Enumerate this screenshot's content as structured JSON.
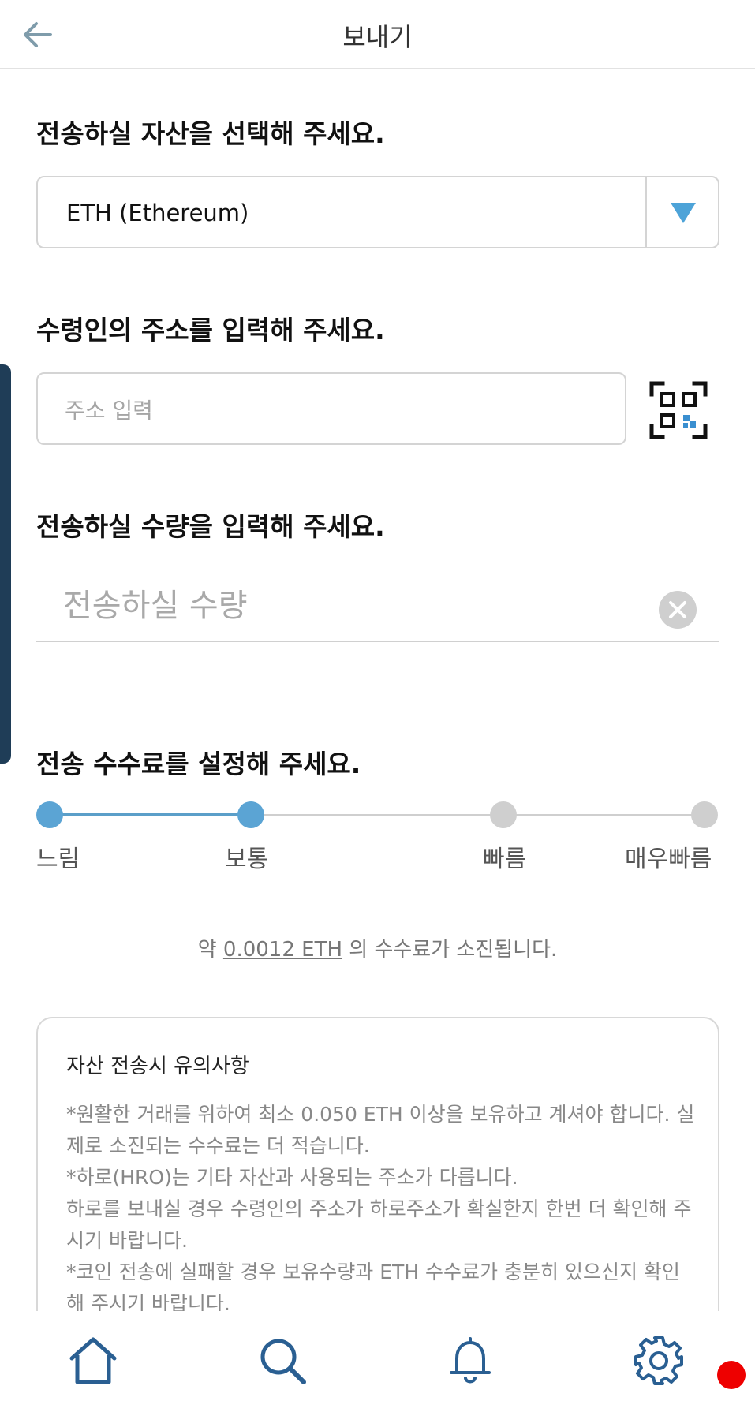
{
  "header": {
    "title": "보내기"
  },
  "asset_section": {
    "title": "전송하실 자산을 선택해 주세요.",
    "selected_asset": "ETH (Ethereum)",
    "arrow_color": "#4da3d8"
  },
  "address_section": {
    "title": "수령인의 주소를 입력해 주세요.",
    "value": "",
    "placeholder": "주소 입력"
  },
  "amount_section": {
    "title": "전송하실 수량을 입력해 주세요.",
    "value": "",
    "placeholder": "전송하실 수량"
  },
  "fee_section": {
    "title": "전송 수수료를 설정해 주세요.",
    "levels": [
      "느림",
      "보통",
      "빠름",
      "매우빠름"
    ],
    "selected_index": 1,
    "info_prefix": "약 ",
    "info_amount": "0.0012 ETH",
    "info_suffix": " 의 수수료가 소진됩니다."
  },
  "notice": {
    "title": "자산 전송시 유의사항",
    "lines": [
      "*원활한 거래를 위하여 최소 0.050 ETH 이상을 보유하고 계셔야 합니다. 실제로 소진되는 수수료는 더 적습니다.",
      "*하로(HRO)는 기타 자산과 사용되는 주소가 다릅니다.",
      "하로를 보내실 경우 수령인의 주소가 하로주소가 확실한지 한번 더 확인해 주시기 바랍니다.",
      "*코인 전송에 실패할 경우 보유수량과 ETH 수수료가 충분히 있으신지 확인해 주시기 바랍니다."
    ]
  },
  "nav": {
    "icons": [
      "home-icon",
      "search-icon",
      "bell-icon",
      "gear-icon"
    ],
    "icon_color": "#2a5f92",
    "alert_color": "#ee0000"
  }
}
